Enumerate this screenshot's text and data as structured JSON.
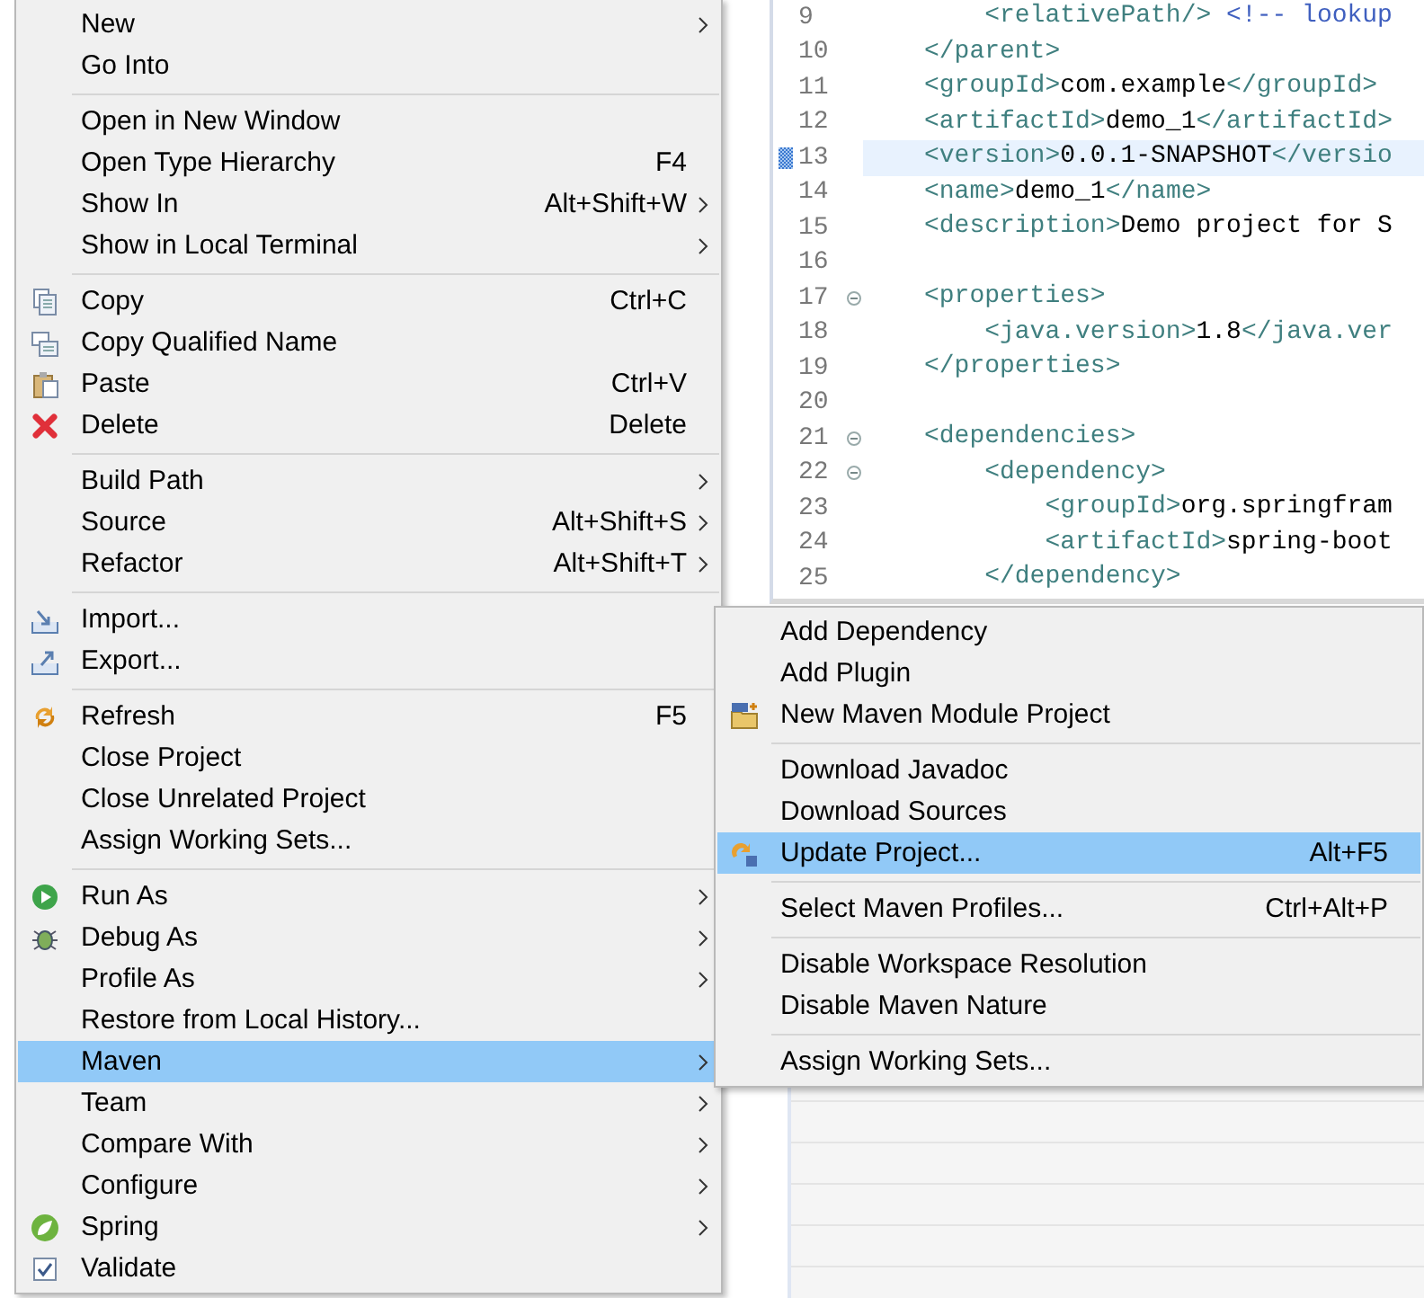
{
  "editor": {
    "lines": [
      {
        "number": "9",
        "fold": false,
        "marked": false,
        "highlighted": false,
        "segments": [
          {
            "kind": "tag",
            "text": "    <relativePath/>"
          },
          {
            "kind": "comment",
            "text": " <!-- lookup"
          }
        ]
      },
      {
        "number": "10",
        "fold": false,
        "marked": false,
        "highlighted": false,
        "segments": [
          {
            "kind": "tag",
            "text": "</parent>"
          }
        ]
      },
      {
        "number": "11",
        "fold": false,
        "marked": false,
        "highlighted": false,
        "segments": [
          {
            "kind": "tag",
            "text": "<groupId>"
          },
          {
            "kind": "text",
            "text": "com.example"
          },
          {
            "kind": "tag",
            "text": "</groupId>"
          }
        ]
      },
      {
        "number": "12",
        "fold": false,
        "marked": false,
        "highlighted": false,
        "segments": [
          {
            "kind": "tag",
            "text": "<artifactId>"
          },
          {
            "kind": "text",
            "text": "demo_1"
          },
          {
            "kind": "tag",
            "text": "</artifactId>"
          }
        ]
      },
      {
        "number": "13",
        "fold": false,
        "marked": true,
        "highlighted": true,
        "segments": [
          {
            "kind": "tag",
            "text": "<version>"
          },
          {
            "kind": "text",
            "text": "0.0.1-SNAPSHOT"
          },
          {
            "kind": "tag",
            "text": "</versio"
          }
        ]
      },
      {
        "number": "14",
        "fold": false,
        "marked": false,
        "highlighted": false,
        "segments": [
          {
            "kind": "tag",
            "text": "<name>"
          },
          {
            "kind": "text",
            "text": "demo_1"
          },
          {
            "kind": "tag",
            "text": "</name>"
          }
        ]
      },
      {
        "number": "15",
        "fold": false,
        "marked": false,
        "highlighted": false,
        "segments": [
          {
            "kind": "tag",
            "text": "<description>"
          },
          {
            "kind": "text",
            "text": "Demo project for S"
          }
        ]
      },
      {
        "number": "16",
        "fold": false,
        "marked": false,
        "highlighted": false
      },
      {
        "number": "17",
        "fold": true,
        "marked": false,
        "highlighted": false,
        "segments": [
          {
            "kind": "tag",
            "text": "<properties>"
          }
        ]
      },
      {
        "number": "18",
        "fold": false,
        "marked": false,
        "highlighted": false,
        "segments": [
          {
            "kind": "tag",
            "text": "    <java.version>"
          },
          {
            "kind": "text",
            "text": "1.8"
          },
          {
            "kind": "tag",
            "text": "</java.ver"
          }
        ]
      },
      {
        "number": "19",
        "fold": false,
        "marked": false,
        "highlighted": false,
        "segments": [
          {
            "kind": "tag",
            "text": "</properties>"
          }
        ]
      },
      {
        "number": "20",
        "fold": false,
        "marked": false,
        "highlighted": false
      },
      {
        "number": "21",
        "fold": true,
        "marked": false,
        "highlighted": false,
        "segments": [
          {
            "kind": "tag",
            "text": "<dependencies>"
          }
        ]
      },
      {
        "number": "22",
        "fold": true,
        "marked": false,
        "highlighted": false,
        "segments": [
          {
            "kind": "tag",
            "text": "    <dependency>"
          }
        ]
      },
      {
        "number": "23",
        "fold": false,
        "marked": false,
        "highlighted": false,
        "segments": [
          {
            "kind": "tag",
            "text": "        <groupId>"
          },
          {
            "kind": "text",
            "text": "org.springfram"
          }
        ]
      },
      {
        "number": "24",
        "fold": false,
        "marked": false,
        "highlighted": false,
        "segments": [
          {
            "kind": "tag",
            "text": "        <artifactId>"
          },
          {
            "kind": "text",
            "text": "spring-boot"
          }
        ]
      },
      {
        "number": "25",
        "fold": false,
        "marked": false,
        "highlighted": false,
        "segments": [
          {
            "kind": "tag",
            "text": "    </dependency>"
          }
        ]
      }
    ]
  },
  "context_menu": {
    "groups": [
      [
        {
          "label": "New",
          "submenu": true,
          "selected": false
        },
        {
          "label": "Go Into",
          "submenu": false,
          "selected": false
        }
      ],
      [
        {
          "label": "Open in New Window",
          "submenu": false,
          "selected": false
        },
        {
          "label": "Open Type Hierarchy",
          "shortcut": "F4",
          "submenu": false,
          "selected": false
        },
        {
          "label": "Show In",
          "shortcut": "Alt+Shift+W",
          "submenu": true,
          "selected": false
        },
        {
          "label": "Show in Local Terminal",
          "submenu": true,
          "selected": false
        }
      ],
      [
        {
          "label": "Copy",
          "shortcut": "Ctrl+C",
          "submenu": false,
          "selected": false
        },
        {
          "label": "Copy Qualified Name",
          "submenu": false,
          "selected": false
        },
        {
          "label": "Paste",
          "shortcut": "Ctrl+V",
          "submenu": false,
          "selected": false
        },
        {
          "label": "Delete",
          "shortcut": "Delete",
          "submenu": false,
          "selected": false
        }
      ],
      [
        {
          "label": "Build Path",
          "submenu": true,
          "selected": false
        },
        {
          "label": "Source",
          "shortcut": "Alt+Shift+S",
          "submenu": true,
          "selected": false
        },
        {
          "label": "Refactor",
          "shortcut": "Alt+Shift+T",
          "submenu": true,
          "selected": false
        }
      ],
      [
        {
          "label": "Import...",
          "submenu": false,
          "selected": false
        },
        {
          "label": "Export...",
          "submenu": false,
          "selected": false
        }
      ],
      [
        {
          "label": "Refresh",
          "shortcut": "F5",
          "submenu": false,
          "selected": false
        },
        {
          "label": "Close Project",
          "submenu": false,
          "selected": false
        },
        {
          "label": "Close Unrelated Project",
          "submenu": false,
          "selected": false
        },
        {
          "label": "Assign Working Sets...",
          "submenu": false,
          "selected": false
        }
      ],
      [
        {
          "label": "Run As",
          "submenu": true,
          "selected": false
        },
        {
          "label": "Debug As",
          "submenu": true,
          "selected": false
        },
        {
          "label": "Profile As",
          "submenu": true,
          "selected": false
        },
        {
          "label": "Restore from Local History...",
          "submenu": false,
          "selected": false
        },
        {
          "label": "Maven",
          "submenu": true,
          "selected": true
        },
        {
          "label": "Team",
          "submenu": true,
          "selected": false
        },
        {
          "label": "Compare With",
          "submenu": true,
          "selected": false
        },
        {
          "label": "Configure",
          "submenu": true,
          "selected": false
        },
        {
          "label": "Spring",
          "submenu": true,
          "selected": false
        },
        {
          "label": "Validate",
          "submenu": false,
          "selected": false
        }
      ]
    ]
  },
  "maven_submenu": {
    "groups": [
      [
        {
          "label": "Add Dependency",
          "selected": false
        },
        {
          "label": "Add Plugin",
          "selected": false
        },
        {
          "label": "New Maven Module Project",
          "selected": false
        }
      ],
      [
        {
          "label": "Download Javadoc",
          "selected": false
        },
        {
          "label": "Download Sources",
          "selected": false
        },
        {
          "label": "Update Project...",
          "shortcut": "Alt+F5",
          "selected": true
        }
      ],
      [
        {
          "label": "Select Maven Profiles...",
          "shortcut": "Ctrl+Alt+P",
          "selected": false
        }
      ],
      [
        {
          "label": "Disable Workspace Resolution",
          "selected": false
        },
        {
          "label": "Disable Maven Nature",
          "selected": false
        }
      ],
      [
        {
          "label": "Assign Working Sets...",
          "selected": false
        }
      ]
    ]
  }
}
